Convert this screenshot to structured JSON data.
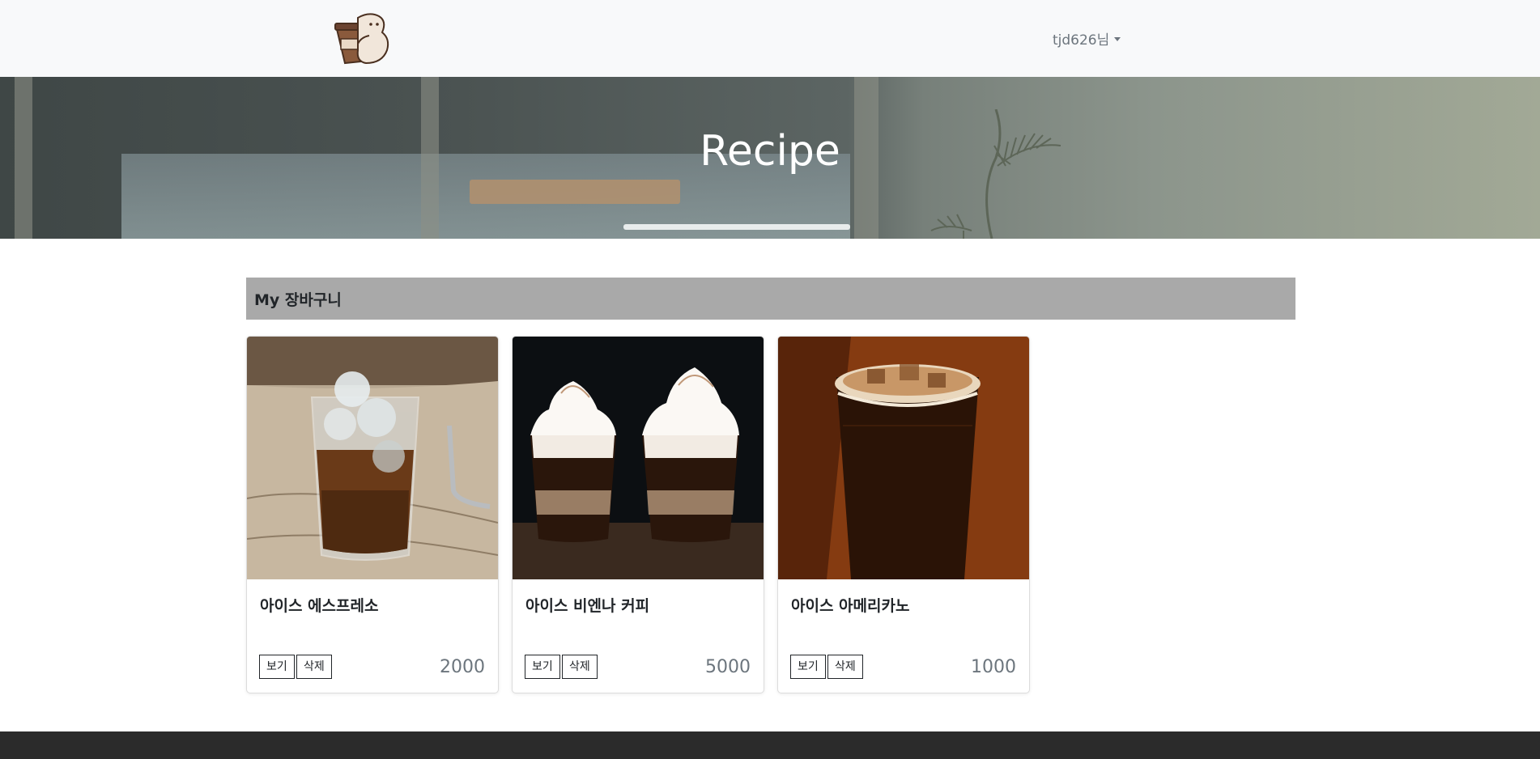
{
  "navbar": {
    "user_label": "tjd626님"
  },
  "hero": {
    "title": "Recipe"
  },
  "section": {
    "title": "My 장바구니"
  },
  "cards": [
    {
      "name": "아이스 에스프레소",
      "view_label": "보기",
      "delete_label": "삭제",
      "price": "2000"
    },
    {
      "name": "아이스 비엔나 커피",
      "view_label": "보기",
      "delete_label": "삭제",
      "price": "5000"
    },
    {
      "name": "아이스 아메리카노",
      "view_label": "보기",
      "delete_label": "삭제",
      "price": "1000"
    }
  ],
  "icons": {
    "logo": "coffee-mascot-logo",
    "dropdown": "caret-down-icon"
  },
  "colors": {
    "navbar_bg": "#f8f9fa",
    "section_header_bg": "#a9a9a9",
    "footer_bg": "#2b2b2b",
    "price_text": "#6c757d"
  }
}
